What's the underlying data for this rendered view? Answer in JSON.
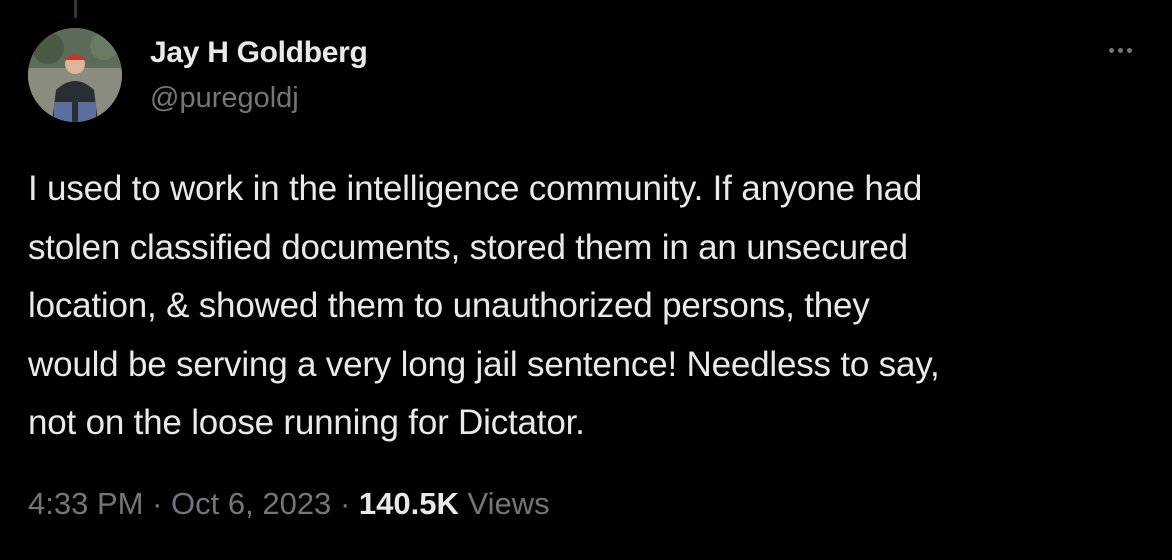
{
  "tweet": {
    "author": {
      "name": "Jay H Goldberg",
      "handle": "@puregoldj",
      "avatar_icon": "profile-photo"
    },
    "more_icon": "more-options-icon",
    "text": "I used to work in the intelligence community. If anyone had\nstolen classified documents, stored them in an unsecured\nlocation, & showed them to unauthorized persons, they\nwould be serving a very long jail sentence! Needless to say,\nnot on the loose running for Dictator.",
    "time": "4:33 PM",
    "separator": "·",
    "date": "Oct 6, 2023",
    "views_count": "140.5K",
    "views_label": "Views"
  },
  "colors": {
    "background": "#000000",
    "primary_text": "#e7e9ea",
    "secondary_text": "#71767b",
    "thread_line": "#333639"
  }
}
